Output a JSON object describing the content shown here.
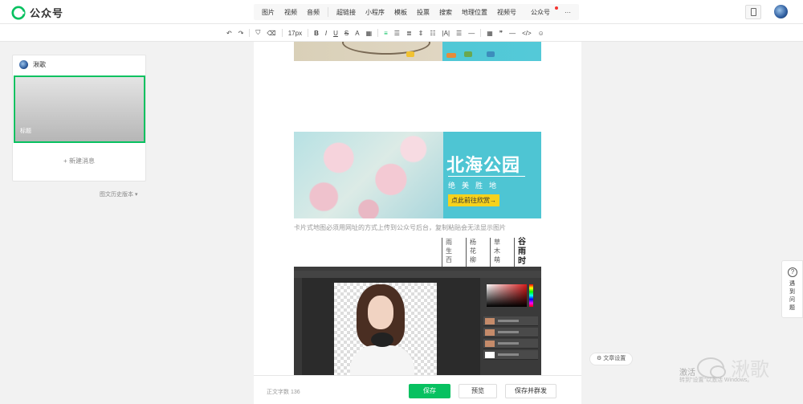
{
  "app": {
    "title": "公众号"
  },
  "insert_menu": {
    "items": [
      "图片",
      "视频",
      "音频",
      "超链接",
      "小程序",
      "模板",
      "投票",
      "搜索",
      "地理位置",
      "视频号",
      "公众号",
      "···"
    ]
  },
  "format_toolbar": {
    "font_size": "17px",
    "items": [
      "B",
      "I",
      "U",
      "S",
      "A"
    ]
  },
  "left_panel": {
    "account_name": "湫歌",
    "cover_title": "标题",
    "new_message": "+ 新建消息",
    "history": "图文历史版本 ▾"
  },
  "editor": {
    "banner": {
      "title": "北海公园",
      "subtitle": "绝美胜地",
      "button": "点此前往欣赏→"
    },
    "caption": "卡片式地图必须用网址的方式上传到公众号后台，复制粘贴会无法显示图片",
    "vertical_columns": [
      {
        "text": "雨生百",
        "bold": false
      },
      {
        "text": "杨花柳",
        "bold": false
      },
      {
        "text": "草木萌",
        "bold": false
      },
      {
        "text": "谷雨时",
        "bold": true
      }
    ]
  },
  "bottom_bar": {
    "word_count": "正文字数 136",
    "save": "保存",
    "preview": "预览",
    "publish": "保存并群发"
  },
  "right_side": {
    "help": "遇到问题",
    "article_settings": "文章设置",
    "activate": "激活",
    "activate_sub": "转到\"设置\"以激活 Windows。",
    "watermark": "湫歌"
  },
  "colors": {
    "brand_green": "#07c160",
    "banner_panel": "#4ec5d3",
    "banner_button": "#f7d21c"
  }
}
